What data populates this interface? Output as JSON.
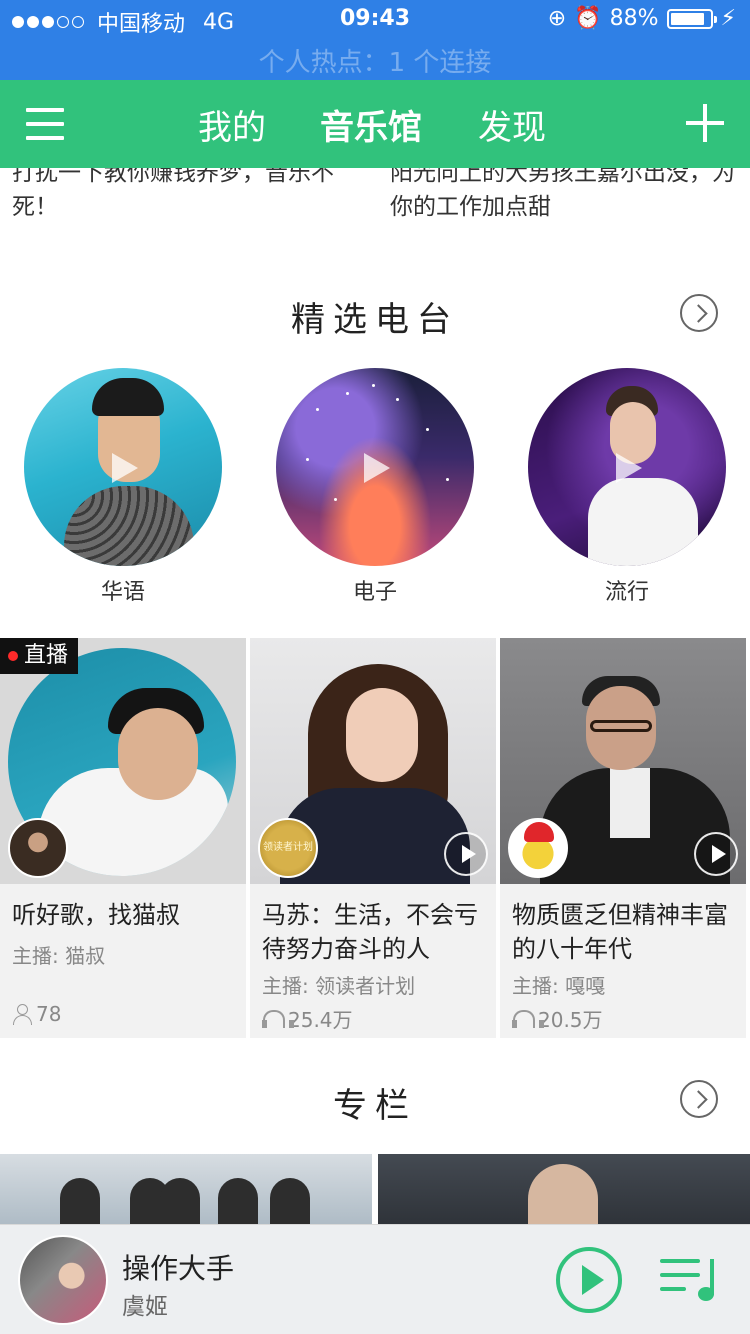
{
  "status_bar": {
    "carrier": "中国移动",
    "network": "4G",
    "time": "09:43",
    "battery": "88%",
    "battery_level": 0.88,
    "hotspot": "个人热点：1 个连接"
  },
  "nav": {
    "tabs": [
      "我的",
      "音乐馆",
      "发现"
    ],
    "active_tab": "音乐馆"
  },
  "top_items": [
    {
      "text": "打扰一下教你赚钱养梦，音乐不死！"
    },
    {
      "text": "阳光向上的大男孩王嘉尔出没，为你的工作加点甜"
    }
  ],
  "radio_section": {
    "title": "精选电台",
    "items": [
      {
        "label": "华语"
      },
      {
        "label": "电子"
      },
      {
        "label": "流行"
      }
    ]
  },
  "live_cards": [
    {
      "badge": "直播",
      "title": "听好歌，找猫叔",
      "host": "主播: 猫叔",
      "count": "78",
      "count_icon": "person-icon"
    },
    {
      "title": "马苏：生活，不会亏待努力奋斗的人",
      "host": "主播: 领读者计划",
      "count": "25.4万",
      "count_icon": "headphone-icon",
      "avatar_text": "领读者计划"
    },
    {
      "title": "物质匮乏但精神丰富的八十年代",
      "host": "主播: 嘎嘎",
      "count": "20.5万",
      "count_icon": "headphone-icon"
    }
  ],
  "column_section": {
    "title": "专栏"
  },
  "player": {
    "song": "操作大手",
    "artist": "虞姬"
  },
  "colors": {
    "status_bar": "#2f80e6",
    "brand_green": "#31c27c",
    "live_red": "#ff2a2a"
  }
}
